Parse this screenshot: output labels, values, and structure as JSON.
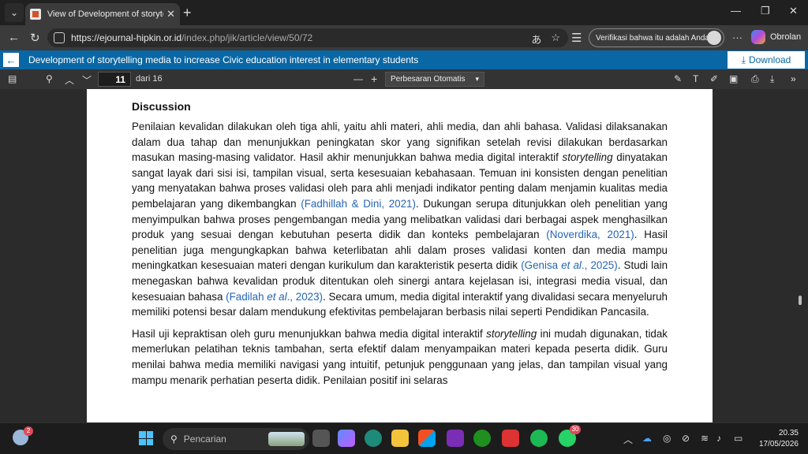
{
  "browser": {
    "tab_title": "View of Development of storytelling",
    "url_host": "https://ejournal-hipkin.or.id",
    "url_path": "/index.php/jik/article/view/50/72",
    "profile_prompt": "Verifikasi bahwa itu adalah Anda",
    "copilot_label": "Obrolan"
  },
  "banner": {
    "title": "Development of storytelling media to increase Civic education interest in elementary students",
    "download_label": "Download"
  },
  "pdf_toolbar": {
    "page_current": "11",
    "page_total": "dari 16",
    "zoom": "Perbesaran Otomatis"
  },
  "document": {
    "heading": "Discussion",
    "p1": [
      {
        "t": "Penilaian kevalidan dilakukan oleh tiga ahli, yaitu ahli materi, ahli media, dan ahli bahasa. Validasi dilaksanakan dalam dua tahap dan menunjukkan peningkatan skor yang signifikan setelah revisi dilakukan berdasarkan masukan masing-masing validator. Hasil akhir menunjukkan bahwa media digital interaktif "
      },
      {
        "t": "storytelling",
        "i": true
      },
      {
        "t": " dinyatakan sangat layak dari sisi isi, tampilan visual, serta kesesuaian kebahasaan. Temuan ini konsisten dengan penelitian yang menyatakan bahwa proses validasi oleh para ahli menjadi indikator penting dalam menjamin kualitas media pembelajaran yang dikembangkan "
      },
      {
        "t": "(Fadhillah & Dini, 2021)",
        "c": true
      },
      {
        "t": ". Dukungan serupa ditunjukkan oleh penelitian yang menyimpulkan bahwa proses pengembangan media yang melibatkan validasi dari berbagai aspek menghasilkan produk yang sesuai dengan kebutuhan peserta didik dan konteks pembelajaran "
      },
      {
        "t": "(Noverdika, 2021)",
        "c": true
      },
      {
        "t": ". Hasil penelitian juga mengungkapkan bahwa keterlibatan ahli dalam proses validasi konten dan media mampu meningkatkan kesesuaian materi dengan kurikulum dan karakteristik peserta didik "
      },
      {
        "t": "(Genisa ",
        "c": true
      },
      {
        "t": "et al",
        "c": true,
        "i": true
      },
      {
        "t": "., 2025)",
        "c": true
      },
      {
        "t": ". Studi lain menegaskan bahwa kevalidan produk ditentukan oleh sinergi antara kejelasan isi, integrasi media visual, dan kesesuaian bahasa "
      },
      {
        "t": "(Fadilah ",
        "c": true
      },
      {
        "t": "et al",
        "c": true,
        "i": true
      },
      {
        "t": "., 2023)",
        "c": true
      },
      {
        "t": ". Secara umum, media digital interaktif yang divalidasi secara menyeluruh memiliki potensi besar dalam mendukung efektivitas pembelajaran berbasis nilai seperti Pendidikan Pancasila."
      }
    ],
    "p2": [
      {
        "t": "Hasil uji kepraktisan oleh guru menunjukkan bahwa media digital interaktif "
      },
      {
        "t": "storytelling",
        "i": true
      },
      {
        "t": " ini mudah digunakan, tidak memerlukan pelatihan teknis tambahan, serta efektif dalam menyampaikan materi kepada peserta didik. Guru menilai bahwa media memiliki navigasi yang intuitif, petunjuk penggunaan yang jelas, dan tampilan visual yang mampu menarik perhatian peserta didik. Penilaian positif ini selaras"
      }
    ]
  },
  "taskbar": {
    "weather_badge": "2",
    "search_placeholder": "Pencarian",
    "whatsapp_badge": "30",
    "time": "20.35",
    "date": "17/05/2026"
  },
  "colors": {
    "banner": "#0a67a5",
    "citation": "#2565b5"
  }
}
